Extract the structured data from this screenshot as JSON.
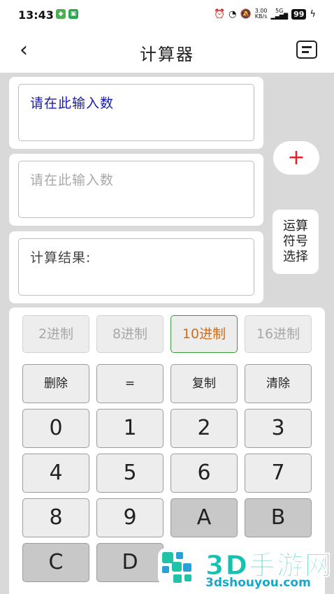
{
  "status": {
    "time": "13:43",
    "speed_top": "3.00",
    "speed_bottom": "KB/s",
    "network": "5G",
    "battery": "99"
  },
  "header": {
    "title": "计算器"
  },
  "inputs": {
    "first_value": "请在此输入数",
    "second_placeholder": "请在此输入数",
    "result_label": "计算结果:"
  },
  "side": {
    "plus_label": "+",
    "operator_select_label": "运算符号选择"
  },
  "bases": [
    {
      "label": "2进制",
      "active": false
    },
    {
      "label": "8进制",
      "active": false
    },
    {
      "label": "10进制",
      "active": true
    },
    {
      "label": "16进制",
      "active": false
    }
  ],
  "function_keys": [
    "删除",
    "=",
    "复制",
    "清除"
  ],
  "digit_keys": [
    "0",
    "1",
    "2",
    "3",
    "4",
    "5",
    "6",
    "7",
    "8",
    "9",
    "A",
    "B",
    "C",
    "D"
  ],
  "watermark": {
    "brand": "3D手游网",
    "url": "3dshouyou.com"
  },
  "colors": {
    "accent_red": "#e0202a",
    "active_base_text": "#d46a12",
    "active_base_border": "#3a9a3a",
    "input_text_blue": "#1a1aa8"
  }
}
